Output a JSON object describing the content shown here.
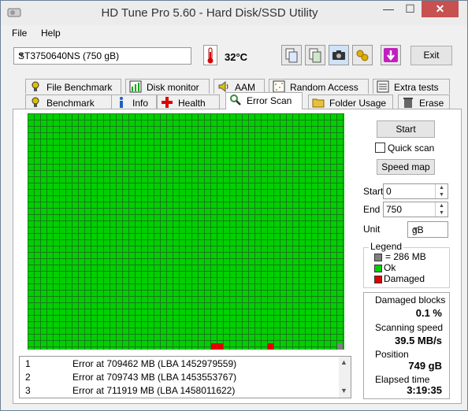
{
  "window": {
    "title": "HD Tune Pro 5.60 - Hard Disk/SSD Utility",
    "minimize": "—",
    "maximize": "☐",
    "close": "✕"
  },
  "menu": {
    "file": "File",
    "help": "Help"
  },
  "toolbar": {
    "drive": "ST3750640NS (750 gB)",
    "temperature": "32°C",
    "exit_label": "Exit",
    "icons": [
      "copy-icon",
      "copy-text-icon",
      "camera-icon",
      "options-icon",
      "save-icon"
    ]
  },
  "tabs": {
    "top": [
      "File Benchmark",
      "Disk monitor",
      "AAM",
      "Random Access",
      "Extra tests"
    ],
    "bottom": [
      "Benchmark",
      "Info",
      "Health",
      "Error Scan",
      "Folder Usage",
      "Erase"
    ],
    "active": "Error Scan"
  },
  "scan": {
    "start_button": "Start",
    "quick_scan_label": "Quick scan",
    "quick_scan_checked": false,
    "speed_map_button": "Speed map",
    "start_label": "Start",
    "start_value": "0",
    "end_label": "End",
    "end_value": "750",
    "unit_label": "Unit",
    "unit_value": "gB"
  },
  "legend": {
    "title": "Legend",
    "block": "= 286 MB",
    "ok": "Ok",
    "damaged": "Damaged",
    "colors": {
      "block": "#808080",
      "ok": "#00d000",
      "damaged": "#e00000"
    }
  },
  "stats": {
    "damaged_blocks_label": "Damaged blocks",
    "damaged_blocks_value": "0.1 %",
    "scanning_speed_label": "Scanning speed",
    "scanning_speed_value": "39.5 MB/s",
    "position_label": "Position",
    "position_value": "749 gB",
    "elapsed_time_label": "Elapsed time",
    "elapsed_time_value": "3:19:35"
  },
  "errors": [
    {
      "num": "1",
      "text": "Error at 709462 MB (LBA 1452979559)"
    },
    {
      "num": "2",
      "text": "Error at 709743 MB (LBA 1453553767)"
    },
    {
      "num": "3",
      "text": "Error at 711919 MB (LBA 1458011622)"
    }
  ]
}
